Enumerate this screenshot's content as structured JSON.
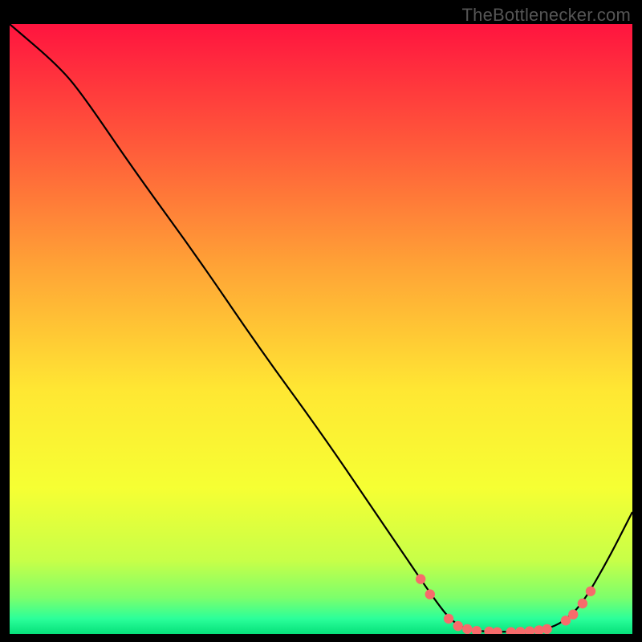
{
  "watermark": "TheBottlenecker.com",
  "chart_data": {
    "type": "line",
    "title": "",
    "xlabel": "",
    "ylabel": "",
    "xlim": [
      0,
      100
    ],
    "ylim": [
      0,
      100
    ],
    "grid": false,
    "legend": false,
    "gradient_stops": [
      {
        "offset": 0.0,
        "color": "#ff143f"
      },
      {
        "offset": 0.2,
        "color": "#ff5a3a"
      },
      {
        "offset": 0.4,
        "color": "#ffa436"
      },
      {
        "offset": 0.6,
        "color": "#ffe733"
      },
      {
        "offset": 0.76,
        "color": "#f6ff33"
      },
      {
        "offset": 0.88,
        "color": "#c7ff48"
      },
      {
        "offset": 0.94,
        "color": "#7dff6b"
      },
      {
        "offset": 0.975,
        "color": "#2bff9a"
      },
      {
        "offset": 1.0,
        "color": "#06e07a"
      }
    ],
    "curve": [
      {
        "x": 0,
        "y": 100
      },
      {
        "x": 8,
        "y": 93
      },
      {
        "x": 12,
        "y": 88
      },
      {
        "x": 20,
        "y": 76
      },
      {
        "x": 30,
        "y": 62
      },
      {
        "x": 40,
        "y": 47
      },
      {
        "x": 50,
        "y": 33
      },
      {
        "x": 58,
        "y": 21
      },
      {
        "x": 64,
        "y": 12
      },
      {
        "x": 68,
        "y": 6
      },
      {
        "x": 71,
        "y": 2
      },
      {
        "x": 74,
        "y": 0.5
      },
      {
        "x": 80,
        "y": 0.3
      },
      {
        "x": 86,
        "y": 0.7
      },
      {
        "x": 89,
        "y": 2
      },
      {
        "x": 92,
        "y": 5
      },
      {
        "x": 96,
        "y": 12
      },
      {
        "x": 100,
        "y": 20
      }
    ],
    "points": [
      {
        "x": 66,
        "y": 9
      },
      {
        "x": 67.5,
        "y": 6.5
      },
      {
        "x": 70.5,
        "y": 2.5
      },
      {
        "x": 72,
        "y": 1.3
      },
      {
        "x": 73.5,
        "y": 0.8
      },
      {
        "x": 75,
        "y": 0.5
      },
      {
        "x": 77,
        "y": 0.4
      },
      {
        "x": 78.3,
        "y": 0.3
      },
      {
        "x": 80.5,
        "y": 0.3
      },
      {
        "x": 82,
        "y": 0.35
      },
      {
        "x": 83.5,
        "y": 0.45
      },
      {
        "x": 85,
        "y": 0.6
      },
      {
        "x": 86.3,
        "y": 0.8
      },
      {
        "x": 89.3,
        "y": 2.2
      },
      {
        "x": 90.5,
        "y": 3.2
      },
      {
        "x": 92,
        "y": 5
      },
      {
        "x": 93.3,
        "y": 7
      }
    ],
    "point_color": "#f76b6b",
    "line_color": "#000000"
  }
}
